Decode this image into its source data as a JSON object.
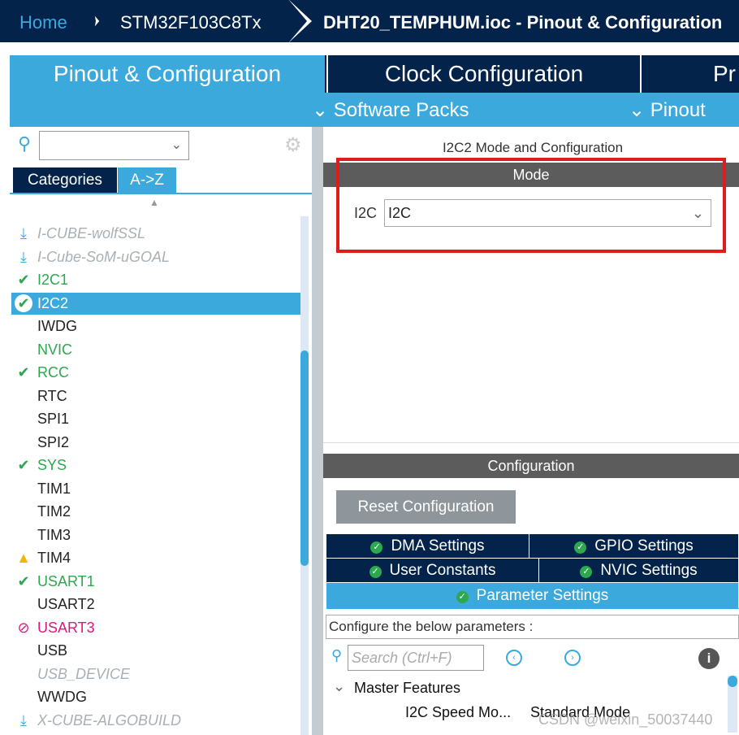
{
  "breadcrumb": [
    "Home",
    "STM32F103C8Tx",
    "DHT20_TEMPHUM.ioc - Pinout & Configuration"
  ],
  "main_tabs": [
    "Pinout & Configuration",
    "Clock Configuration",
    "Pr"
  ],
  "sub_menu": [
    "Software Packs",
    "Pinout"
  ],
  "left": {
    "search_value": "",
    "tabs": [
      "Categories",
      "A->Z"
    ],
    "active_tab": "A->Z",
    "items": [
      {
        "label": "I-CUBE-wolfSSL",
        "state": "pack"
      },
      {
        "label": "I-Cube-SoM-uGOAL",
        "state": "pack"
      },
      {
        "label": "I2C1",
        "state": "ok"
      },
      {
        "label": "I2C2",
        "state": "selected"
      },
      {
        "label": "IWDG",
        "state": "none"
      },
      {
        "label": "NVIC",
        "state": "green"
      },
      {
        "label": "RCC",
        "state": "ok"
      },
      {
        "label": "RTC",
        "state": "none"
      },
      {
        "label": "SPI1",
        "state": "none"
      },
      {
        "label": "SPI2",
        "state": "none"
      },
      {
        "label": "SYS",
        "state": "ok"
      },
      {
        "label": "TIM1",
        "state": "none"
      },
      {
        "label": "TIM2",
        "state": "none"
      },
      {
        "label": "TIM3",
        "state": "none"
      },
      {
        "label": "TIM4",
        "state": "warning"
      },
      {
        "label": "USART1",
        "state": "ok"
      },
      {
        "label": "USART2",
        "state": "none"
      },
      {
        "label": "USART3",
        "state": "disabled"
      },
      {
        "label": "USB",
        "state": "none"
      },
      {
        "label": "USB_DEVICE",
        "state": "unavailable"
      },
      {
        "label": "WWDG",
        "state": "none"
      },
      {
        "label": "X-CUBE-ALGOBUILD",
        "state": "pack"
      }
    ]
  },
  "right": {
    "title": "I2C2 Mode and Configuration",
    "mode_header": "Mode",
    "mode_label": "I2C",
    "mode_value": "I2C",
    "config_header": "Configuration",
    "reset_button": "Reset Configuration",
    "tabs": [
      "DMA Settings",
      "GPIO Settings",
      "User Constants",
      "NVIC Settings",
      "Parameter Settings"
    ],
    "configure_text": "Configure the below parameters :",
    "search_placeholder": "Search (Ctrl+F)",
    "group": "Master Features",
    "param_name": "I2C Speed Mo...",
    "param_value": "Standard Mode"
  },
  "watermark": "CSDN @weixin_50037440",
  "colors": {
    "navy": "#03234b",
    "accent": "#3ca9dc",
    "highlight": "#e01b1b"
  }
}
